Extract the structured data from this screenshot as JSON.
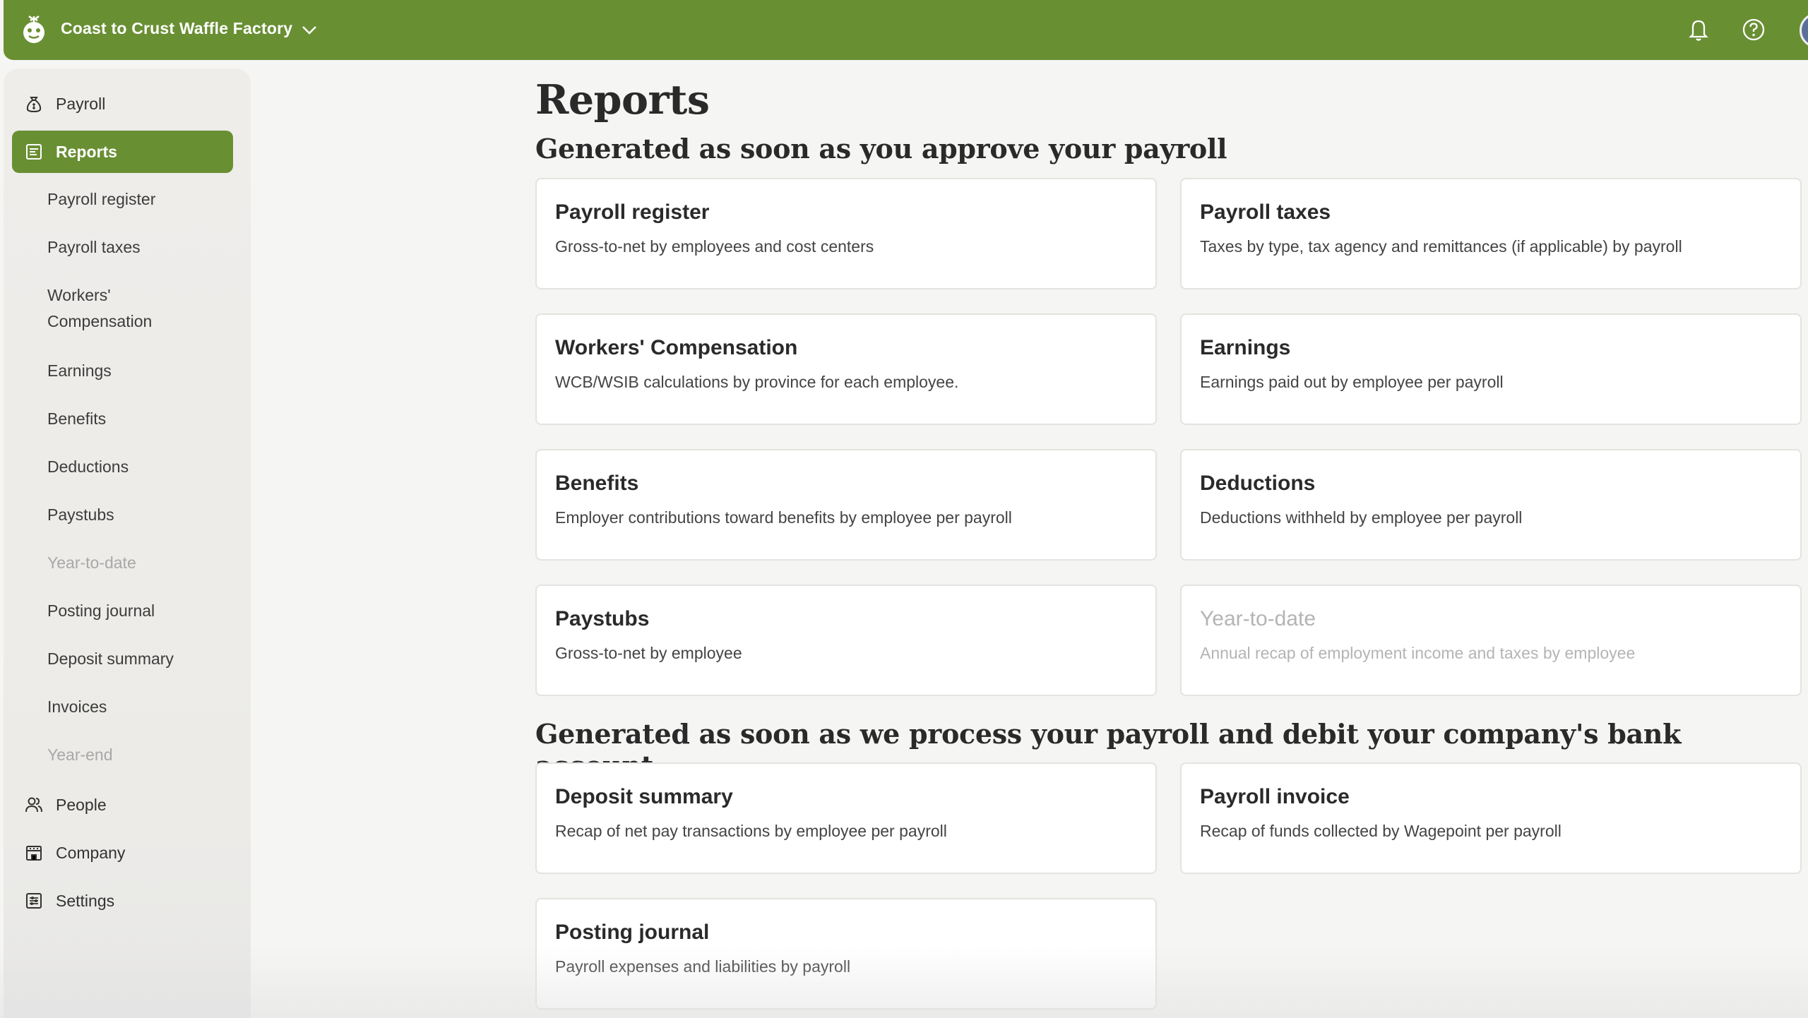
{
  "header": {
    "company_name": "Coast to Crust Waffle Factory",
    "brand_color": "#698f33"
  },
  "sidebar": {
    "items": [
      {
        "label": "Payroll",
        "icon": "money-bag-icon"
      },
      {
        "label": "Reports",
        "icon": "report-icon",
        "active": true
      },
      {
        "label": "People",
        "icon": "people-icon"
      },
      {
        "label": "Company",
        "icon": "building-icon"
      },
      {
        "label": "Settings",
        "icon": "settings-icon"
      }
    ],
    "sub_items": [
      {
        "label": "Payroll register"
      },
      {
        "label": "Payroll taxes"
      },
      {
        "label": "Workers' Compensation"
      },
      {
        "label": "Earnings"
      },
      {
        "label": "Benefits"
      },
      {
        "label": "Deductions"
      },
      {
        "label": "Paystubs"
      },
      {
        "label": "Year-to-date",
        "disabled": true
      },
      {
        "label": "Posting journal"
      },
      {
        "label": "Deposit summary"
      },
      {
        "label": "Invoices"
      },
      {
        "label": "Year-end",
        "disabled": true
      }
    ]
  },
  "main": {
    "title": "Reports",
    "sections": [
      {
        "title": "Generated as soon as you approve your payroll",
        "cards": [
          {
            "title": "Payroll register",
            "desc": "Gross-to-net by employees and cost centers"
          },
          {
            "title": "Payroll taxes",
            "desc": "Taxes by type, tax agency and remittances (if applicable) by payroll"
          },
          {
            "title": "Workers' Compensation",
            "desc": "WCB/WSIB calculations by province for each employee."
          },
          {
            "title": "Earnings",
            "desc": "Earnings paid out by employee per payroll"
          },
          {
            "title": "Benefits",
            "desc": "Employer contributions toward benefits by employee per payroll"
          },
          {
            "title": "Deductions",
            "desc": "Deductions withheld by employee per payroll"
          },
          {
            "title": "Paystubs",
            "desc": "Gross-to-net by employee"
          },
          {
            "title": "Year-to-date",
            "desc": "Annual recap of employment income and taxes by employee",
            "disabled": true
          }
        ]
      },
      {
        "title": "Generated as soon as we process your payroll and debit your company's bank account",
        "cards": [
          {
            "title": "Deposit summary",
            "desc": "Recap of net pay transactions by employee per payroll"
          },
          {
            "title": "Payroll invoice",
            "desc": "Recap of funds collected by Wagepoint per payroll"
          },
          {
            "title": "Posting journal",
            "desc": "Payroll expenses and liabilities by payroll"
          }
        ]
      }
    ]
  }
}
